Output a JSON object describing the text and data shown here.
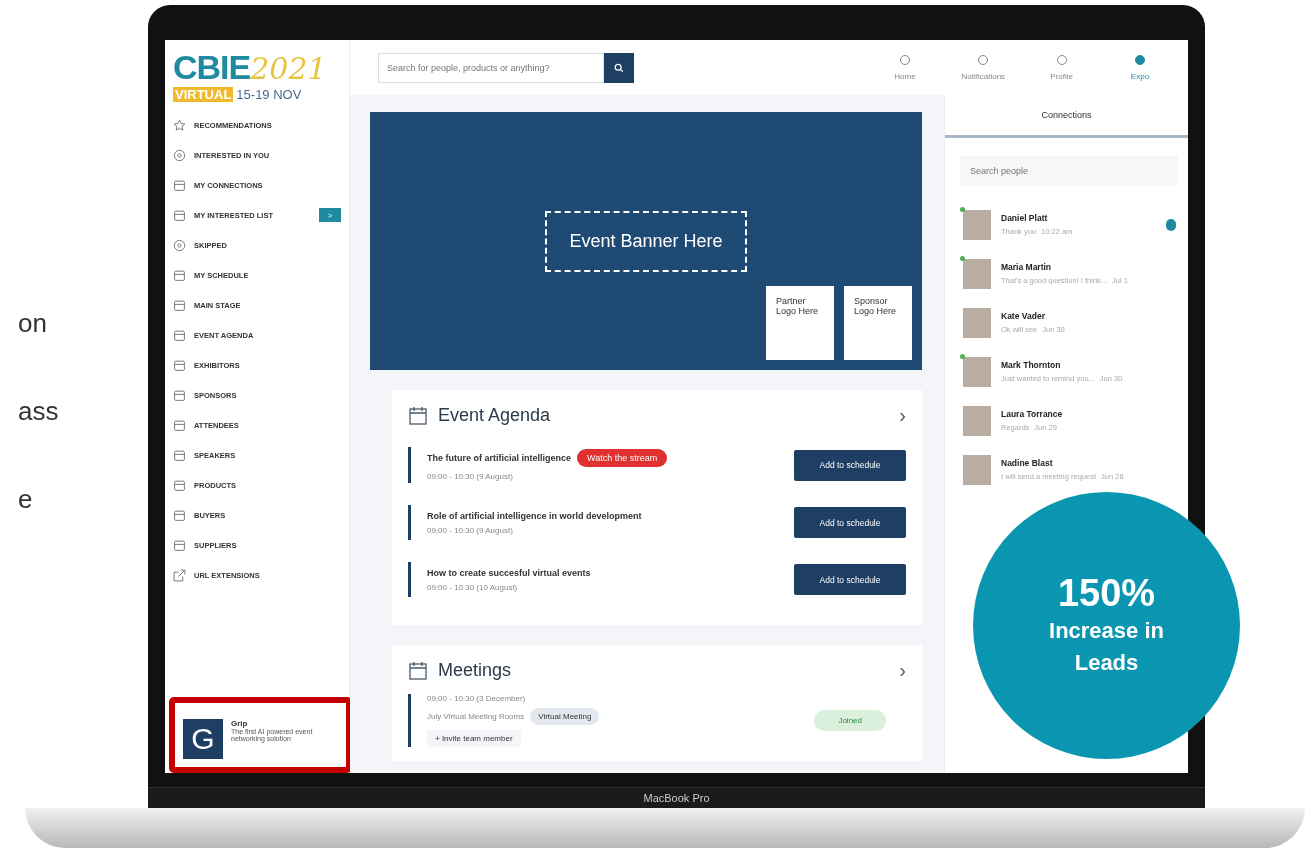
{
  "side_text": [
    "on",
    "ass",
    "e"
  ],
  "sidebar": {
    "logo": {
      "name": "CBIE",
      "year": "2021",
      "badge": "VIRTUAL",
      "dates": "15-19 NOV"
    },
    "items": [
      {
        "label": "RECOMMENDATIONS"
      },
      {
        "label": "INTERESTED IN YOU"
      },
      {
        "label": "MY CONNECTIONS"
      },
      {
        "label": "MY INTERESTED LIST"
      },
      {
        "label": "SKIPPED"
      },
      {
        "label": "MY SCHEDULE"
      },
      {
        "label": "MAIN STAGE"
      },
      {
        "label": "EVENT AGENDA"
      },
      {
        "label": "EXHIBITORS"
      },
      {
        "label": "SPONSORS"
      },
      {
        "label": "ATTENDEES"
      },
      {
        "label": "SPEAKERS"
      },
      {
        "label": "PRODUCTS"
      },
      {
        "label": "BUYERS"
      },
      {
        "label": "SUPPLIERS"
      },
      {
        "label": "URL EXTENSIONS"
      }
    ],
    "collapse_button": ">",
    "sponsor": {
      "logo": "G",
      "name": "Grip",
      "description": "The first AI powered event networking solution",
      "highlighted": true
    }
  },
  "topbar": {
    "search": {
      "placeholder": "Search for people, products or anything?"
    },
    "tabs": [
      {
        "label": "Home",
        "selected": false
      },
      {
        "label": "Notifications",
        "selected": false
      },
      {
        "label": "Profile",
        "selected": false
      },
      {
        "label": "Expo",
        "selected": true
      }
    ]
  },
  "banner": {
    "title": "Event Banner Here",
    "logos": [
      "Partner Logo Here",
      "Sponsor Logo Here"
    ]
  },
  "agenda": {
    "title": "Event Agenda",
    "more": "›",
    "sessions": [
      {
        "title": "The future of artificial intelligence",
        "time": "09:00 - 10:30 (9 August)",
        "badge": "Watch the stream",
        "button": "Add to schedule"
      },
      {
        "title": "Role of artificial intelligence in world development",
        "time": "09:00 - 10:30 (9 August)",
        "button": "Add to schedule"
      },
      {
        "title": "How to create succesful virtual events",
        "time": "09:00 - 10:30 (10 August)",
        "button": "Add to schedule"
      }
    ]
  },
  "meetings": {
    "title": "Meetings",
    "more": "›",
    "items": [
      {
        "time": "09:00 - 10:30 (3 December)",
        "location": "July Virtual Meeting Rooms",
        "chip": "Virtual Meeting",
        "invite": "+ Invite team member",
        "status": "Joined"
      }
    ]
  },
  "connections": {
    "title": "Connections",
    "search": {
      "placeholder": "Search people"
    },
    "people": [
      {
        "name": "Daniel Platt",
        "message": "Thank you",
        "time": "10:22 am",
        "online": true,
        "unread": true
      },
      {
        "name": "Maria Martin",
        "message": "That's a good question! I think...",
        "time": "Jul 1",
        "online": true,
        "unread": false
      },
      {
        "name": "Kate Vader",
        "message": "Ok will see",
        "time": "Jun 30",
        "online": false,
        "unread": false
      },
      {
        "name": "Mark Thornton",
        "message": "Just wanted to remind you...",
        "time": "Jun 30",
        "online": true,
        "unread": false
      },
      {
        "name": "Laura Torrance",
        "message": "Regards",
        "time": "Jun 29",
        "online": false,
        "unread": false
      },
      {
        "name": "Nadine Blast",
        "message": "I will send a meeting request",
        "time": "Jun 28",
        "online": false,
        "unread": false
      }
    ]
  },
  "stat": {
    "value": "150%",
    "label": "Increase in Leads"
  },
  "device_label": "MacBook Pro"
}
